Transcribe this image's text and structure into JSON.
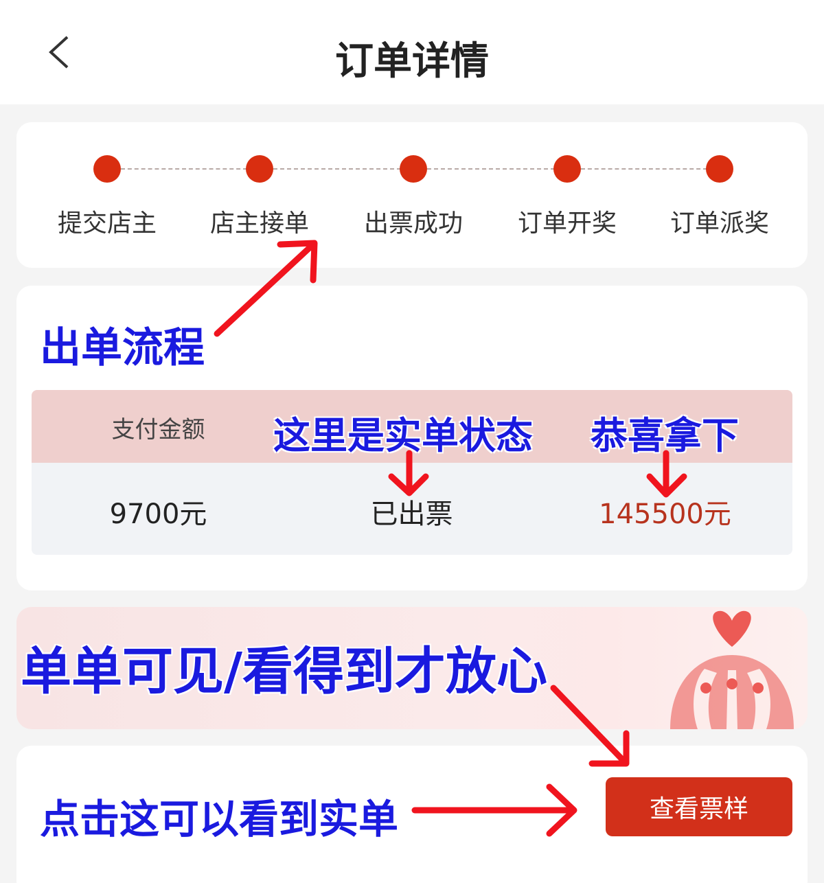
{
  "header": {
    "title": "订单详情",
    "back_icon": "chevron-left-icon"
  },
  "steps": [
    {
      "label": "提交店主"
    },
    {
      "label": "店主接单"
    },
    {
      "label": "出票成功"
    },
    {
      "label": "订单开奖"
    },
    {
      "label": "订单派奖"
    }
  ],
  "order_table": {
    "headers": [
      "支付金额",
      "",
      ""
    ],
    "values": [
      "9700元",
      "已出票",
      "145500元"
    ]
  },
  "actions": {
    "view_ticket_label": "查看票样"
  },
  "annotations": {
    "flow": "出单流程",
    "status": "这里是实单状态",
    "win": "恭喜拿下",
    "visible": "单单可见/看得到才放心",
    "click": "点击这可以看到实单"
  },
  "colors": {
    "accent": "#d92e10",
    "button": "#d2301a",
    "annotation_text": "#1a1adf",
    "annotation_arrow": "#f0141e",
    "table_header": "#efcfcd"
  }
}
